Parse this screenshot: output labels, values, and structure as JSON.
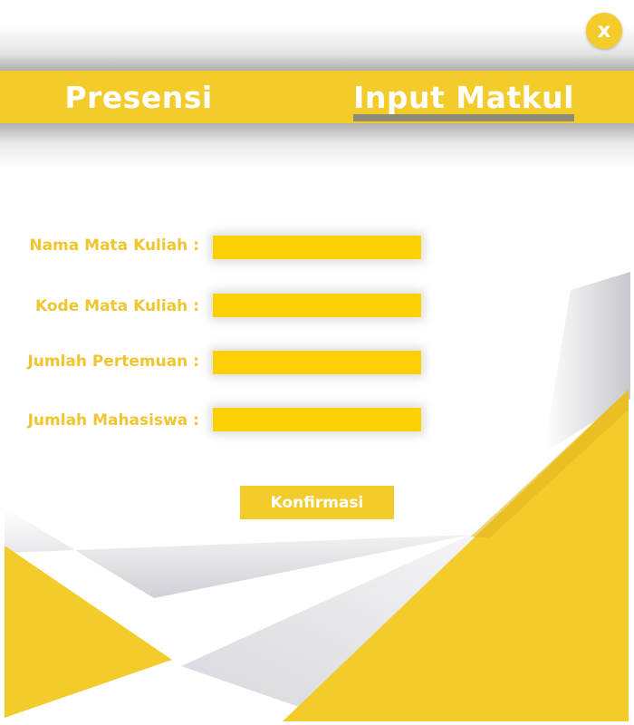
{
  "window": {
    "close_label": "x"
  },
  "nav": {
    "tabs": [
      {
        "label": "Presensi",
        "active": false
      },
      {
        "label": "Input Matkul",
        "active": true
      }
    ]
  },
  "form": {
    "fields": [
      {
        "label": "Nama Mata Kuliah :",
        "value": "",
        "placeholder": ""
      },
      {
        "label": "Kode Mata Kuliah :",
        "value": "",
        "placeholder": ""
      },
      {
        "label": "Jumlah Pertemuan :",
        "value": "",
        "placeholder": ""
      },
      {
        "label": "Jumlah Mahasiswa :",
        "value": "",
        "placeholder": ""
      }
    ],
    "submit_label": "Konfirmasi"
  },
  "colors": {
    "accent": "#f3cb2a",
    "input_fill": "#fdd106",
    "label_text": "#f0c530",
    "tab_underline": "#8f8b75"
  }
}
